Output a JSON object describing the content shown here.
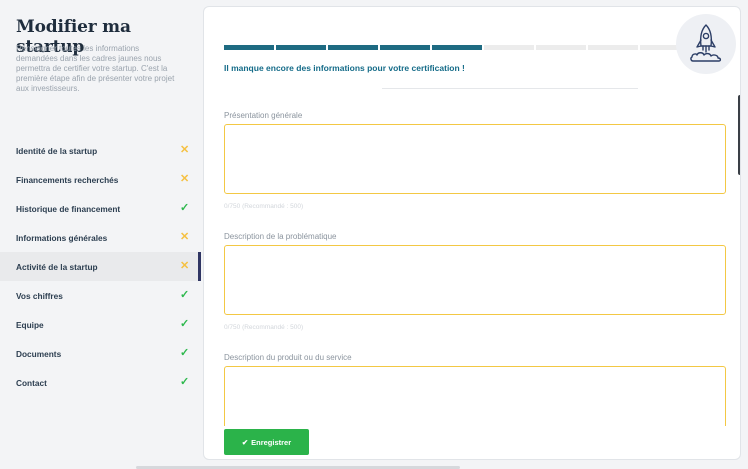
{
  "sidebar": {
    "title": "Modifier ma startup",
    "description": "Renseigner toutes les informations demandées dans les cadres jaunes nous permettra de certifier votre startup. C'est la première étape afin de présenter votre projet aux investisseurs.",
    "items": [
      {
        "label": "Identité de la startup",
        "status": "✕",
        "state": "incomplete"
      },
      {
        "label": "Financements recherchés",
        "status": "✕",
        "state": "incomplete"
      },
      {
        "label": "Historique de financement",
        "status": "✓",
        "state": "complete"
      },
      {
        "label": "Informations générales",
        "status": "✕",
        "state": "incomplete"
      },
      {
        "label": "Activité de la startup",
        "status": "✕",
        "state": "incomplete",
        "active": true
      },
      {
        "label": "Vos chiffres",
        "status": "✓",
        "state": "complete"
      },
      {
        "label": "Equipe",
        "status": "✓",
        "state": "complete"
      },
      {
        "label": "Documents",
        "status": "✓",
        "state": "complete"
      },
      {
        "label": "Contact",
        "status": "✓",
        "state": "complete"
      }
    ]
  },
  "progress": {
    "completed_steps": 5,
    "total_steps": 9
  },
  "main": {
    "certification_message": "Il manque encore des informations pour votre certification !",
    "fields": [
      {
        "label": "Présentation générale",
        "counter": "0/750 (Recommandé : 500)"
      },
      {
        "label": "Description de la problématique",
        "counter": "0/750 (Recommandé : 500)"
      },
      {
        "label": "Description du produit ou du service",
        "counter": ""
      }
    ],
    "save_button": "Enregistrer",
    "save_icon": "✔"
  },
  "colors": {
    "brand": "#1e6b82",
    "warning": "#f5c142",
    "success": "#2db84d",
    "field_border": "#f3c844",
    "active_indicator": "#2f3563"
  },
  "icons": {
    "rocket": "rocket-icon",
    "check": "check-icon",
    "cross": "cross-icon"
  }
}
